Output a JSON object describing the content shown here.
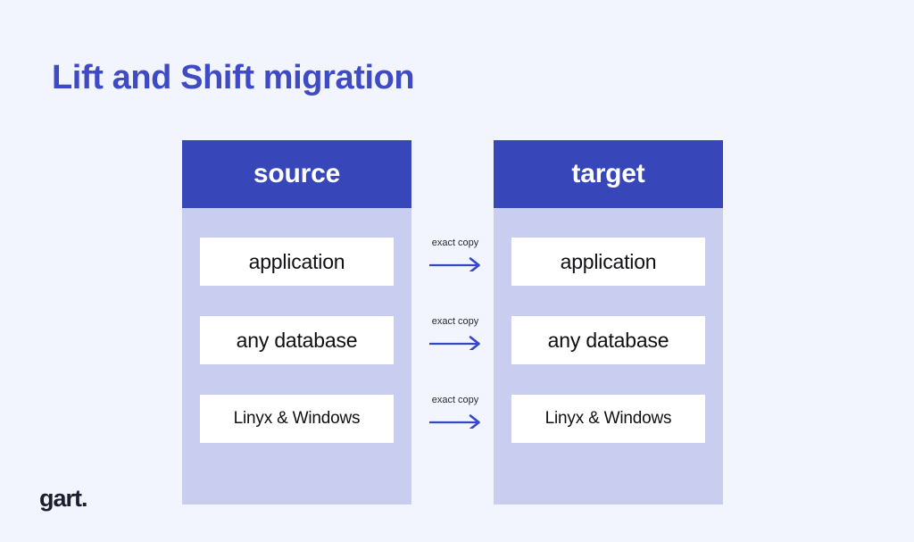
{
  "page": {
    "title": "Lift and Shift migration",
    "background_color": "#f2f5fe"
  },
  "colors": {
    "title_text": "#3f4bc4",
    "header_fill": "#3746b8",
    "column_fill": "#c9cdf0",
    "item_fill": "#ffffff",
    "item_text": "#101014",
    "arrow": "#3746c4",
    "connector_label_text": "#2b2b33",
    "logo_text": "#1d1d30"
  },
  "diagram": {
    "type": "two-column-mapping",
    "columns": [
      {
        "key": "source",
        "header": "source",
        "items": [
          {
            "label": "application"
          },
          {
            "label": "any database"
          },
          {
            "label": "Linyx & Windows"
          }
        ]
      },
      {
        "key": "target",
        "header": "target",
        "items": [
          {
            "label": "application"
          },
          {
            "label": "any database"
          },
          {
            "label": "Linyx & Windows"
          }
        ]
      }
    ],
    "connectors": [
      {
        "label": "exact copy",
        "icon": "arrow-right-icon"
      },
      {
        "label": "exact copy",
        "icon": "arrow-right-icon"
      },
      {
        "label": "exact copy",
        "icon": "arrow-right-icon"
      }
    ]
  },
  "branding": {
    "logo_text": "gart."
  }
}
